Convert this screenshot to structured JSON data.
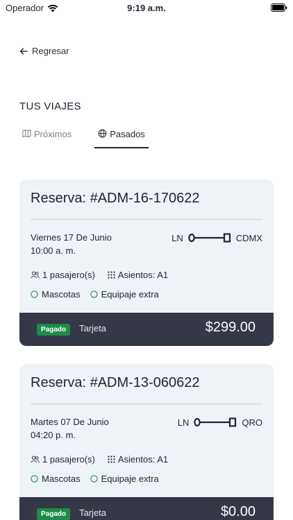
{
  "status_bar": {
    "carrier": "Operador",
    "time": "9:19 a.m."
  },
  "nav": {
    "back_label": "Regresar"
  },
  "page": {
    "title": "TUS VIAJES"
  },
  "tabs": [
    {
      "label": "Próximos",
      "icon": "map-icon",
      "active": false
    },
    {
      "label": "Pasados",
      "icon": "globe-icon",
      "active": true
    }
  ],
  "colors": {
    "card_bg": "#eef3f8",
    "footer_bg": "#353846",
    "paid_badge": "#1f8a4c",
    "text": "#1f2330"
  },
  "bookings": [
    {
      "title": "Reserva: #ADM-16-170622",
      "date": "Viernes 17 De Junio",
      "time": "10:00 a. m.",
      "origin": "LN",
      "destination": "CDMX",
      "passengers": "1 pasajero(s)",
      "seats": "Asientos: A1",
      "extras": [
        "Mascotas",
        "Equipaje extra"
      ],
      "status": "Pagado",
      "payment_method": "Tarjeta",
      "amount": "$299.00"
    },
    {
      "title": "Reserva: #ADM-13-060622",
      "date": "Martes 07 De Junio",
      "time": "04:20 p. m.",
      "origin": "LN",
      "destination": "QRO",
      "passengers": "1 pasajero(s)",
      "seats": "Asientos: A1",
      "extras": [
        "Mascotas",
        "Equipaje extra"
      ],
      "status": "Pagado",
      "payment_method": "Tarjeta",
      "amount": "$0.00"
    }
  ]
}
